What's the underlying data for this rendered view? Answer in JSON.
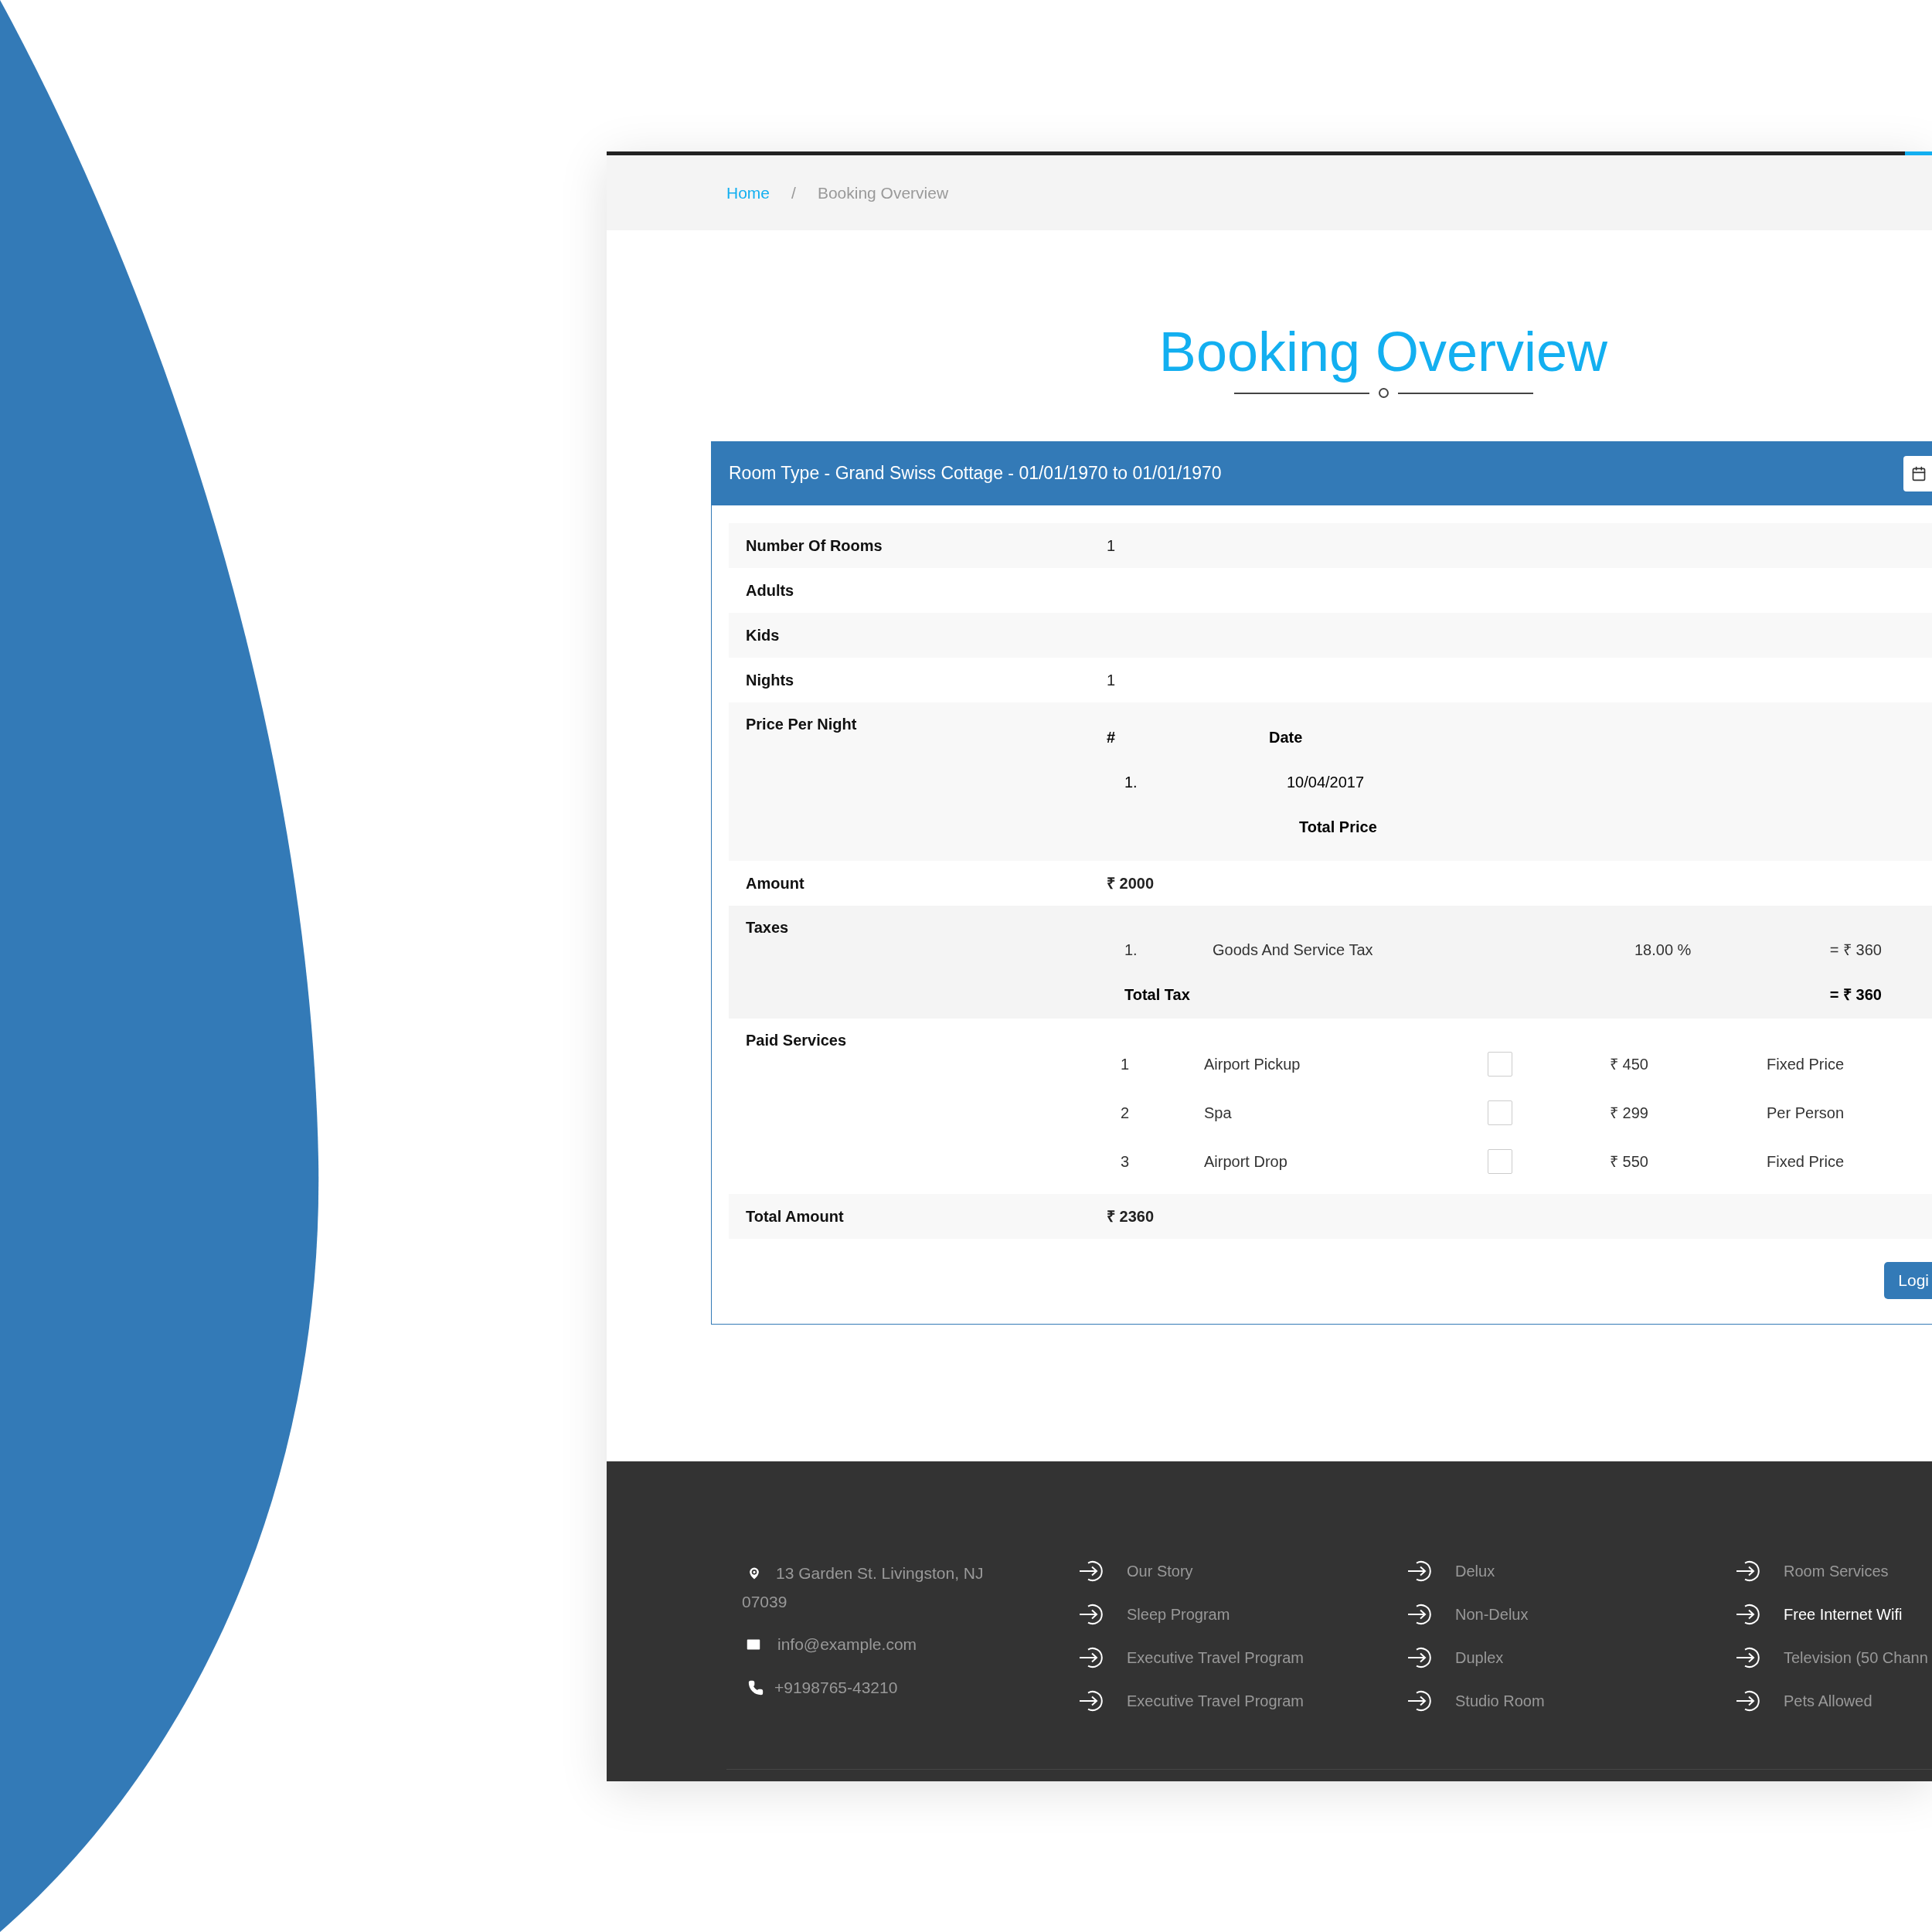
{
  "breadcrumb": {
    "items": [
      {
        "label": "Home",
        "kind": "link"
      },
      {
        "label": "Booking Overview",
        "kind": "current"
      }
    ],
    "separator": "/"
  },
  "page_title": "Booking Overview",
  "booking": {
    "header": "Room Type - Grand Swiss Cottage - 01/01/1970 to 01/01/1970",
    "rows": [
      {
        "kind": "text",
        "label": "Number Of Rooms",
        "value": "1"
      },
      {
        "kind": "text",
        "label": "Adults"
      },
      {
        "kind": "text",
        "label": "Kids"
      },
      {
        "kind": "text",
        "label": "Nights",
        "value": "1"
      },
      {
        "kind": "prices",
        "label": "Price Per Night",
        "columns": [
          "#",
          "Date"
        ],
        "items": [
          {
            "number": "1.",
            "date": "10/04/2017"
          }
        ],
        "total_label": "Total Price"
      },
      {
        "kind": "amount",
        "label": "Amount",
        "value": "₹ 2000"
      },
      {
        "kind": "taxes",
        "label": "Taxes",
        "items": [
          {
            "number": "1.",
            "name": "Goods And Service Tax",
            "rate": "18.00 %",
            "amount": "= ₹ 360"
          }
        ],
        "total_label": "Total Tax",
        "total": "= ₹ 360"
      },
      {
        "kind": "services",
        "label": "Paid Services",
        "items": [
          {
            "number": "1",
            "name": "Airport Pickup",
            "checked": false,
            "price": "₹ 450",
            "pricing": "Fixed Price"
          },
          {
            "number": "2",
            "name": "Spa",
            "checked": false,
            "price": "₹ 299",
            "pricing": "Per Person"
          },
          {
            "number": "3",
            "name": "Airport Drop",
            "checked": false,
            "price": "₹ 550",
            "pricing": "Fixed Price"
          }
        ]
      },
      {
        "kind": "amount",
        "label": "Total Amount",
        "value": "₹ 2360"
      }
    ],
    "button": "Logi"
  },
  "footer": {
    "contact": [
      {
        "kind": "address",
        "text": "13 Garden St. Livingston, NJ 07039"
      },
      {
        "kind": "email",
        "text": "info@example.com"
      },
      {
        "kind": "phone",
        "text": "+9198765-43210"
      }
    ],
    "link_columns": [
      [
        {
          "label": "Our Story",
          "highlighted": false
        },
        {
          "label": "Sleep Program",
          "highlighted": false
        },
        {
          "label": "Executive Travel Program",
          "highlighted": false
        },
        {
          "label": "Executive Travel Program",
          "highlighted": false
        }
      ],
      [
        {
          "label": "Delux",
          "highlighted": false
        },
        {
          "label": "Non-Delux",
          "highlighted": false
        },
        {
          "label": "Duplex",
          "highlighted": false
        },
        {
          "label": "Studio Room",
          "highlighted": false
        }
      ],
      [
        {
          "label": "Room Services",
          "highlighted": false
        },
        {
          "label": "Free Internet Wifi",
          "highlighted": true
        },
        {
          "label": "Television (50 Chann",
          "highlighted": false
        },
        {
          "label": "Pets Allowed",
          "highlighted": false
        }
      ]
    ]
  }
}
